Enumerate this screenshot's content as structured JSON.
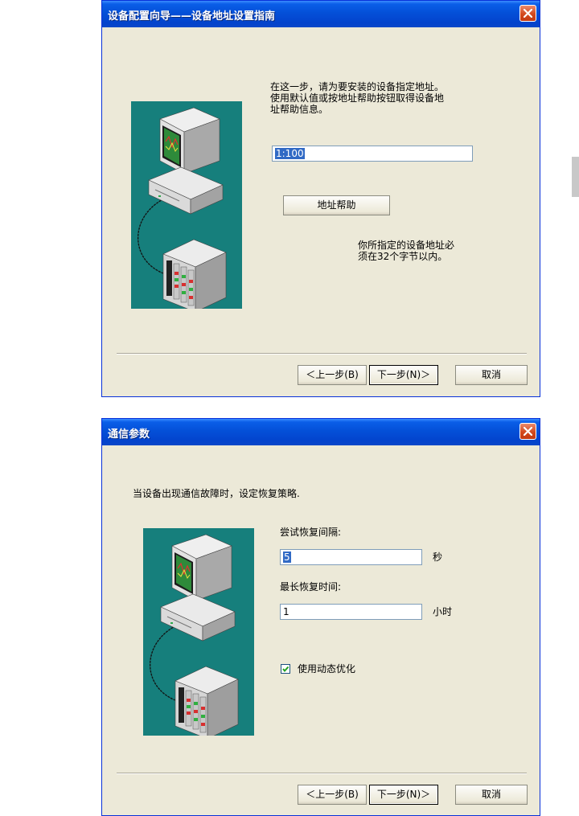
{
  "window1": {
    "title": "设备配置向导——设备地址设置指南",
    "intro_lines": [
      "在这一步，请为要安装的设备指定地址。",
      "使用默认值或按地址帮助按钮取得设备地",
      "址帮助信息。"
    ],
    "address_value": "1:100",
    "help_button": "地址帮助",
    "note_lines": [
      "你所指定的设备地址必",
      "须在32个字节以内。"
    ],
    "back_button": "＜上一步(B)",
    "next_button": "下一步(N)＞",
    "cancel_button": "取消"
  },
  "window2": {
    "title": "通信参数",
    "description": "当设备出现通信故障时，设定恢复策略.",
    "retry_interval_label": "尝试恢复间隔:",
    "retry_interval_value": "5",
    "retry_interval_unit": "秒",
    "max_recovery_label": "最长恢复时间:",
    "max_recovery_value": "1",
    "max_recovery_unit": "小时",
    "dynamic_opt_label": "使用动态优化",
    "dynamic_opt_checked": true,
    "back_button": "＜上一步(B)",
    "next_button": "下一步(N)＞",
    "cancel_button": "取消"
  },
  "colors": {
    "titlebar": "#0450d8",
    "dialog_bg": "#ece9d8",
    "illustration_bg": "#167f7c",
    "close_button": "#d3491e",
    "selection": "#316ac5"
  },
  "icons": [
    "close-icon",
    "computer-icon",
    "device-rack-icon",
    "checkmark-icon"
  ]
}
